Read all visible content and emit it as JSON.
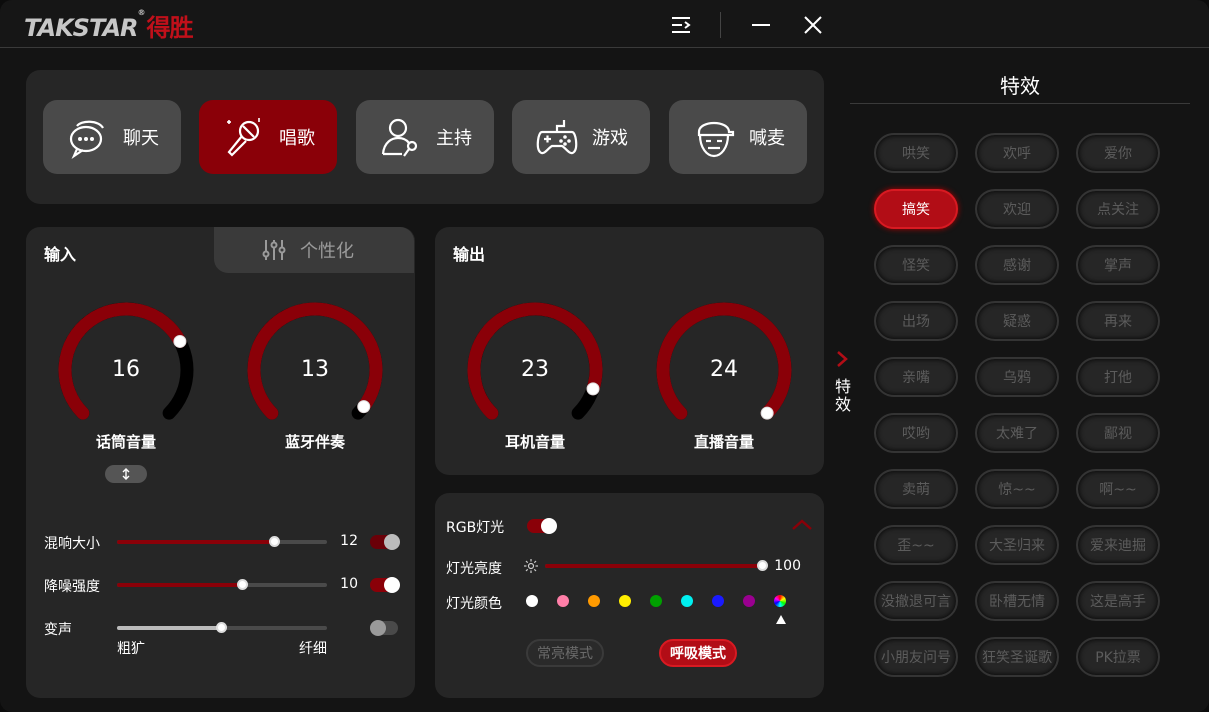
{
  "brand": {
    "en": "TAKSTAR",
    "cn": "得胜",
    "reg": "®"
  },
  "modes": [
    {
      "label": "聊天",
      "icon": "chat-icon",
      "active": false
    },
    {
      "label": "唱歌",
      "icon": "microphone-icon",
      "active": true
    },
    {
      "label": "主持",
      "icon": "host-icon",
      "active": false
    },
    {
      "label": "游戏",
      "icon": "gamepad-icon",
      "active": false
    },
    {
      "label": "喊麦",
      "icon": "mc-face-icon",
      "active": false
    }
  ],
  "input": {
    "title": "输入",
    "personal_tab": "个性化",
    "knobs": [
      {
        "label": "话筒音量",
        "value": "16",
        "level": 0.73
      },
      {
        "label": "蓝牙伴奏",
        "value": "13",
        "level": 0.97
      }
    ],
    "rows": [
      {
        "label": "混响大小",
        "value": "12",
        "level": 0.75,
        "toggle": "half"
      },
      {
        "label": "降噪强度",
        "value": "10",
        "level": 0.6,
        "toggle": "on"
      },
      {
        "label": "变声",
        "value": "",
        "level": 0.5,
        "toggle": "off",
        "left_label": "粗犷",
        "right_label": "纤细"
      }
    ]
  },
  "output": {
    "title": "输出",
    "knobs": [
      {
        "label": "耳机音量",
        "value": "23",
        "level": 0.9
      },
      {
        "label": "直播音量",
        "value": "24",
        "level": 1.0
      }
    ]
  },
  "rgb": {
    "title": "RGB灯光",
    "brightness_label": "灯光亮度",
    "brightness_value": "100",
    "brightness_level": 1.0,
    "color_label": "灯光颜色",
    "colors": [
      "#ffffff",
      "#ff7fa8",
      "#ff9a00",
      "#ffee00",
      "#00a000",
      "#00f0f0",
      "#1a1aff",
      "#9a0090",
      "rainbow"
    ],
    "selected_color_index": 8,
    "mode_steady": "常亮模式",
    "mode_breath": "呼吸模式",
    "active_mode": "breath"
  },
  "effects": {
    "title": "特效",
    "side_label": "特效",
    "items": [
      "哄笑",
      "欢呼",
      "爱你",
      "搞笑",
      "欢迎",
      "点关注",
      "怪笑",
      "感谢",
      "掌声",
      "出场",
      "疑惑",
      "再来",
      "亲嘴",
      "乌鸦",
      "打他",
      "哎哟",
      "太难了",
      "鄙视",
      "卖萌",
      "惊~~",
      "啊~~",
      "歪~~",
      "大圣归来",
      "爱来迪掘",
      "没撤退可言",
      "卧槽无情",
      "这是高手",
      "小朋友问号",
      "狂笑圣诞歌",
      "PK拉票"
    ],
    "active_index": 3
  },
  "colors": {
    "accent": "#8a0008",
    "panel": "#262626",
    "background": "#141414"
  }
}
